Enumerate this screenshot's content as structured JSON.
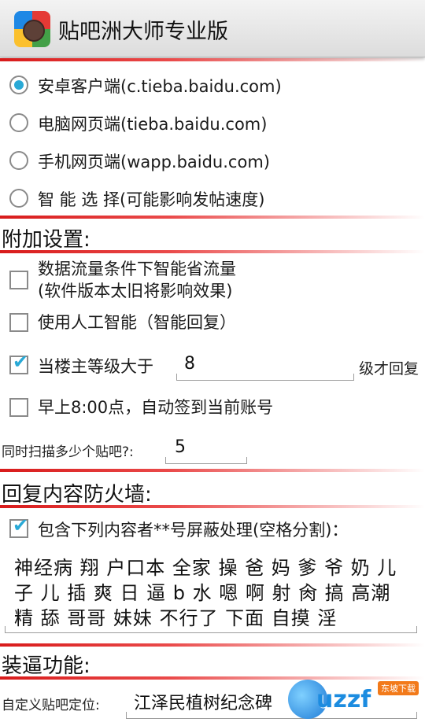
{
  "app": {
    "title": "贴吧洲大师专业版"
  },
  "login_modes": [
    {
      "label": "安卓客户端(c.tieba.baidu.com)",
      "selected": true
    },
    {
      "label": "电脑网页端(tieba.baidu.com)",
      "selected": false
    },
    {
      "label": "手机网页端(wapp.baidu.com)",
      "selected": false
    },
    {
      "label": "智 能 选 择(可能影响发帖速度)",
      "selected": false
    }
  ],
  "addon": {
    "header": "附加设置:",
    "data_saver": {
      "line1": "数据流量条件下智能省流量",
      "line2": "(软件版本太旧将影响效果)",
      "checked": false
    },
    "ai_reply": {
      "label": "使用人工智能（智能回复）",
      "checked": false
    },
    "level_reply": {
      "label": "当楼主等级大于",
      "value": "8",
      "suffix": "级才回复",
      "checked": true
    },
    "auto_sign": {
      "label": "早上8:00点，自动签到当前账号",
      "checked": false
    },
    "scan_count": {
      "label": "同时扫描多少个贴吧?:",
      "value": "5"
    }
  },
  "firewall": {
    "header": "回复内容防火墙:",
    "filter": {
      "label": "包含下列内容者**号屏蔽处理(空格分割)：",
      "checked": true
    },
    "keywords": "神经病 翔 户口本 全家 操 爸 妈 爹 爷 奶 儿 子 儿 插 爽 日 逼 b 水 嗯 啊 射 肏 搞 高潮 精 舔 哥哥 妹妹 不行了 下面 自摸 淫"
  },
  "pretend": {
    "header": "装逼功能:",
    "locate_label": "自定义贴吧定位:",
    "locate_value": "江泽民植树纪念碑"
  },
  "watermark": {
    "text": "uzzf",
    "badge": "东坡下载"
  },
  "colors": {
    "accent": "#29a9d6",
    "divider": "#d81b1b"
  }
}
